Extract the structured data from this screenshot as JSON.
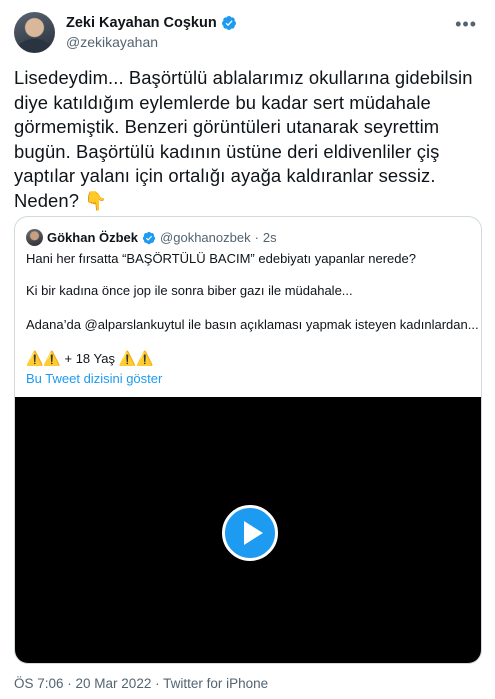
{
  "author": {
    "display_name": "Zeki Kayahan Coşkun",
    "handle": "@zekikayahan",
    "verified": true
  },
  "more_icon": "more-horizontal-icon",
  "tweet": {
    "text": "Lisedeydim... Başörtülü ablalarımız okullarına gidebilsin\ndiye katıldığım eylemlerde bu kadar sert müdahale\ngörmemiştik. Benzeri görüntüleri utanarak seyrettim\nbugün. Başörtülü kadının üstüne deri eldivenliler çiş\nyaptılar yalanı için ortalığı ayağa kaldıranlar sessiz.\nNeden? 👇"
  },
  "quoted": {
    "display_name": "Gökhan Özbek",
    "handle": "@gokhanozbek",
    "separator": "·",
    "time": "2s",
    "verified": true,
    "line1": "Hani her fırsatta “BAŞÖRTÜLÜ BACIM” edebiyatı yapanlar nerede?",
    "line2": "Ki bir kadına önce jop ile sonra biber gazı ile müdahale...",
    "line3": "Adana’da @alparslankuytul ile basın açıklaması yapmak isteyen kadınlardan...",
    "line4_warn_left": "⚠️⚠️",
    "line4_text": " + 18 Yaş ",
    "line4_warn_right": "⚠️⚠️",
    "thread_link": "Bu Tweet dizisini göster",
    "video": {
      "play_icon": "play-icon"
    }
  },
  "meta": {
    "time": "ÖS 7:06",
    "dot1": " · ",
    "date": "20 Mar 2022",
    "dot2": " · ",
    "source": "Twitter for iPhone"
  },
  "colors": {
    "accent": "#1d9bf0",
    "secondary_text": "#536471",
    "border": "#cfd9de"
  }
}
